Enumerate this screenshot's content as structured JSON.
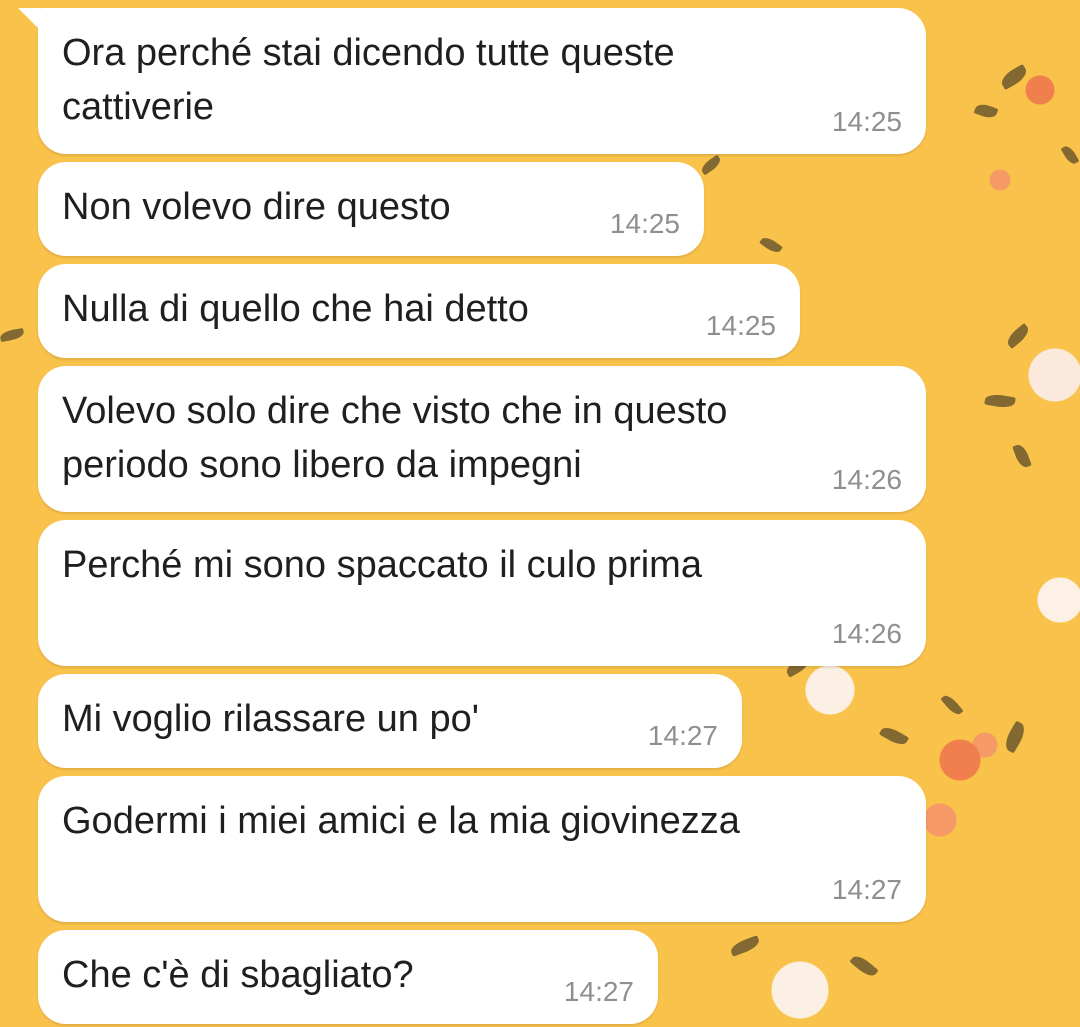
{
  "chat": {
    "messages": [
      {
        "text": "Ora perché stai dicendo tutte queste\ncattiverie",
        "time": "14:25"
      },
      {
        "text": "Non volevo dire questo",
        "time": "14:25"
      },
      {
        "text": "Nulla di quello che hai detto",
        "time": "14:25"
      },
      {
        "text": "Volevo solo dire che visto che in questo\nperiodo sono libero da impegni",
        "time": "14:26"
      },
      {
        "text": "Perché mi sono spaccato il culo prima",
        "time": "14:26"
      },
      {
        "text": "Mi voglio rilassare un po'",
        "time": "14:27"
      },
      {
        "text": "Godermi i miei amici e la mia giovinezza",
        "time": "14:27"
      },
      {
        "text": "Che c'è di sbagliato?",
        "time": "14:27"
      }
    ]
  },
  "colors": {
    "wallpaper": "#f9c24a",
    "bubble": "#ffffff",
    "text": "#1f1f1f",
    "timestamp": "#8f8f8f"
  }
}
